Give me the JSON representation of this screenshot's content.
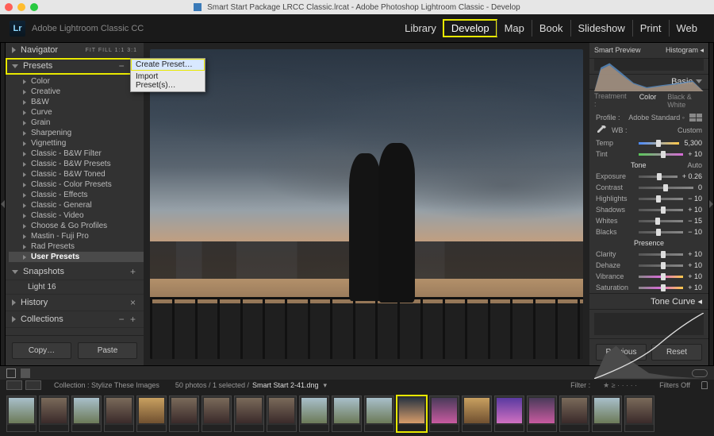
{
  "window": {
    "title": "Smart Start Package LRCC Classic.lrcat - Adobe Photoshop Lightroom Classic - Develop"
  },
  "app": {
    "logo_text": "Lr",
    "name": "Adobe Lightroom Classic CC"
  },
  "modules": {
    "items": [
      "Library",
      "Develop",
      "Map",
      "Book",
      "Slideshow",
      "Print",
      "Web"
    ],
    "active": "Develop"
  },
  "left": {
    "navigator": {
      "label": "Navigator",
      "modes": "FIT   FILL   1:1   3:1"
    },
    "presets": {
      "label": "Presets",
      "plusminus": "−  +",
      "folders": [
        "Color",
        "Creative",
        "B&W",
        "Curve",
        "Grain",
        "Sharpening",
        "Vignetting",
        "Classic - B&W Filter",
        "Classic - B&W Presets",
        "Classic - B&W Toned",
        "Classic - Color Presets",
        "Classic - Effects",
        "Classic - General",
        "Classic - Video",
        "Choose & Go Profiles",
        "Mastin - Fuji Pro",
        "Rad Presets",
        "User Presets"
      ],
      "selected": "User Presets"
    },
    "context_menu": {
      "create": "Create Preset…",
      "import": "Import Preset(s)…"
    },
    "snapshots": {
      "label": "Snapshots",
      "plus": "+",
      "item": "Light 16"
    },
    "history": {
      "label": "History",
      "x": "×"
    },
    "collections": {
      "label": "Collections",
      "plusminus": "−  +"
    },
    "copy_btn": "Copy…",
    "paste_btn": "Paste"
  },
  "right": {
    "smart_preview": "Smart Preview",
    "histogram_label": "Histogram  ◂",
    "basic_label": "Basic",
    "treatment_label": "Treatment :",
    "treat_color": "Color",
    "treat_bw": "Black & White",
    "profile_label": "Profile :",
    "profile_value": "Adobe Standard   ◦",
    "wb_label": "WB :",
    "wb_value": "Custom",
    "temp": {
      "label": "Temp",
      "value": "5,300",
      "pos": 48
    },
    "tint": {
      "label": "Tint",
      "value": "+ 10",
      "pos": 55
    },
    "tone_label": "Tone",
    "auto_label": "Auto",
    "exposure": {
      "label": "Exposure",
      "value": "+ 0.26",
      "pos": 53
    },
    "contrast": {
      "label": "Contrast",
      "value": "0",
      "pos": 50
    },
    "highlights": {
      "label": "Highlights",
      "value": "− 10",
      "pos": 45
    },
    "shadows": {
      "label": "Shadows",
      "value": "+ 10",
      "pos": 55
    },
    "whites": {
      "label": "Whites",
      "value": "− 15",
      "pos": 42
    },
    "blacks": {
      "label": "Blacks",
      "value": "− 10",
      "pos": 45
    },
    "presence_label": "Presence",
    "clarity": {
      "label": "Clarity",
      "value": "+ 10",
      "pos": 55
    },
    "dehaze": {
      "label": "Dehaze",
      "value": "+ 10",
      "pos": 55
    },
    "vibrance": {
      "label": "Vibrance",
      "value": "+ 10",
      "pos": 55
    },
    "saturation": {
      "label": "Saturation",
      "value": "+ 10",
      "pos": 55
    },
    "tonecurve_label": "Tone Curve  ◂",
    "previous_btn": "Previous",
    "reset_btn": "Reset"
  },
  "toolbar": {
    "dot_colors": [
      "#d44",
      "#d84",
      "#dd4",
      "#4d4",
      "#48d",
      "#84d"
    ]
  },
  "filmstrip": {
    "collection_label": "Collection : Stylize These Images",
    "count_label": "50 photos / 1 selected /",
    "filename": "Smart Start 2-41.dng",
    "filter_label": "Filter :",
    "filters_off": "Filters Off",
    "thumbs": [
      "a",
      "b",
      "a",
      "b",
      "e",
      "b",
      "b",
      "b",
      "b",
      "a",
      "a",
      "a",
      "d",
      "c",
      "e",
      "f",
      "c",
      "b",
      "a",
      "b"
    ],
    "selected_index": 12
  }
}
